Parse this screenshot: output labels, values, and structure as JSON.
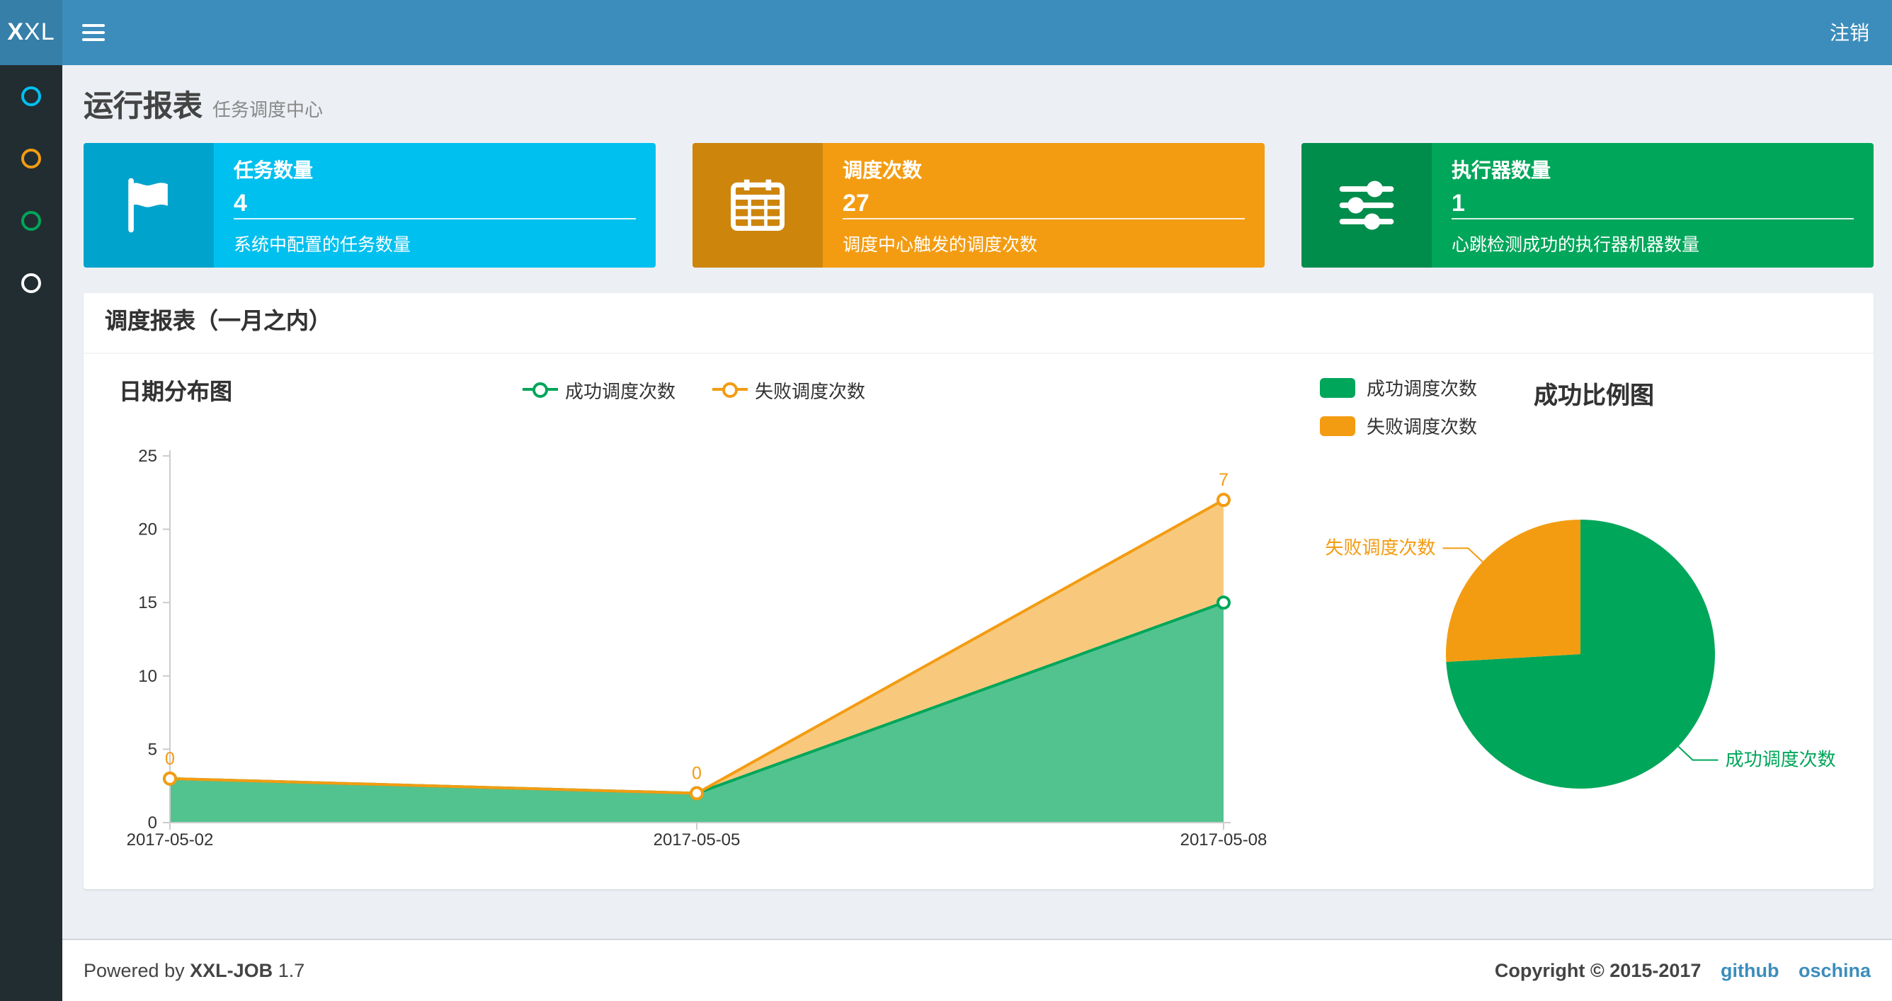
{
  "navbar": {
    "logo_bold": "X",
    "logo_rest": "XL",
    "logout": "注销",
    "bg_color": "#3c8dbc",
    "logo_bg_color": "#367fa9"
  },
  "sidebar": {
    "bg_color": "#222d32",
    "items": [
      {
        "icon": "circle-icon",
        "color": "#00c0ef"
      },
      {
        "icon": "circle-icon",
        "color": "#f39c12"
      },
      {
        "icon": "circle-icon",
        "color": "#00a65a"
      },
      {
        "icon": "circle-icon",
        "color": "#ffffff"
      }
    ]
  },
  "header": {
    "title": "运行报表",
    "subtitle": "任务调度中心"
  },
  "info_boxes": [
    {
      "icon": "flag-icon",
      "title": "任务数量",
      "value": "4",
      "desc": "系统中配置的任务数量",
      "color": "#00c0ef",
      "icon_bg": "#00a3cc"
    },
    {
      "icon": "calendar-icon",
      "title": "调度次数",
      "value": "27",
      "desc": "调度中心触发的调度次数",
      "color": "#f39c12",
      "icon_bg": "#cd850c"
    },
    {
      "icon": "sliders-icon",
      "title": "执行器数量",
      "value": "1",
      "desc": "心跳检测成功的执行器机器数量",
      "color": "#00a65a",
      "icon_bg": "#008d4c"
    }
  ],
  "panel": {
    "title": "调度报表（一月之内）"
  },
  "chart_data": [
    {
      "type": "area",
      "title": "日期分布图",
      "categories": [
        "2017-05-02",
        "2017-05-05",
        "2017-05-08"
      ],
      "series": [
        {
          "name": "成功调度次数",
          "values": [
            3,
            2,
            15
          ],
          "color": "#00a65a"
        },
        {
          "name": "失败调度次数",
          "values": [
            0,
            0,
            7
          ],
          "color": "#f39c12"
        }
      ],
      "stacked": true,
      "point_labels": {
        "series": "失败调度次数",
        "values": [
          0,
          0,
          7
        ]
      },
      "ylim": [
        0,
        25
      ],
      "yticks": [
        0,
        5,
        10,
        15,
        20,
        25
      ],
      "xlabel": "",
      "ylabel": "",
      "grid": false,
      "legend_position": "top-center"
    },
    {
      "type": "pie",
      "title": "成功比例图",
      "slices": [
        {
          "name": "成功调度次数",
          "value": 20,
          "color": "#00a65a"
        },
        {
          "name": "失败调度次数",
          "value": 7,
          "color": "#f39c12"
        }
      ],
      "total": 27,
      "legend_position": "top-left",
      "legend": [
        "成功调度次数",
        "失败调度次数"
      ]
    }
  ],
  "footer": {
    "powered_prefix": "Powered by",
    "product": "XXL-JOB",
    "version": "1.7",
    "copyright": "Copyright © 2015-2017",
    "links": [
      "github",
      "oschina"
    ],
    "link_color": "#3c8dbc"
  }
}
